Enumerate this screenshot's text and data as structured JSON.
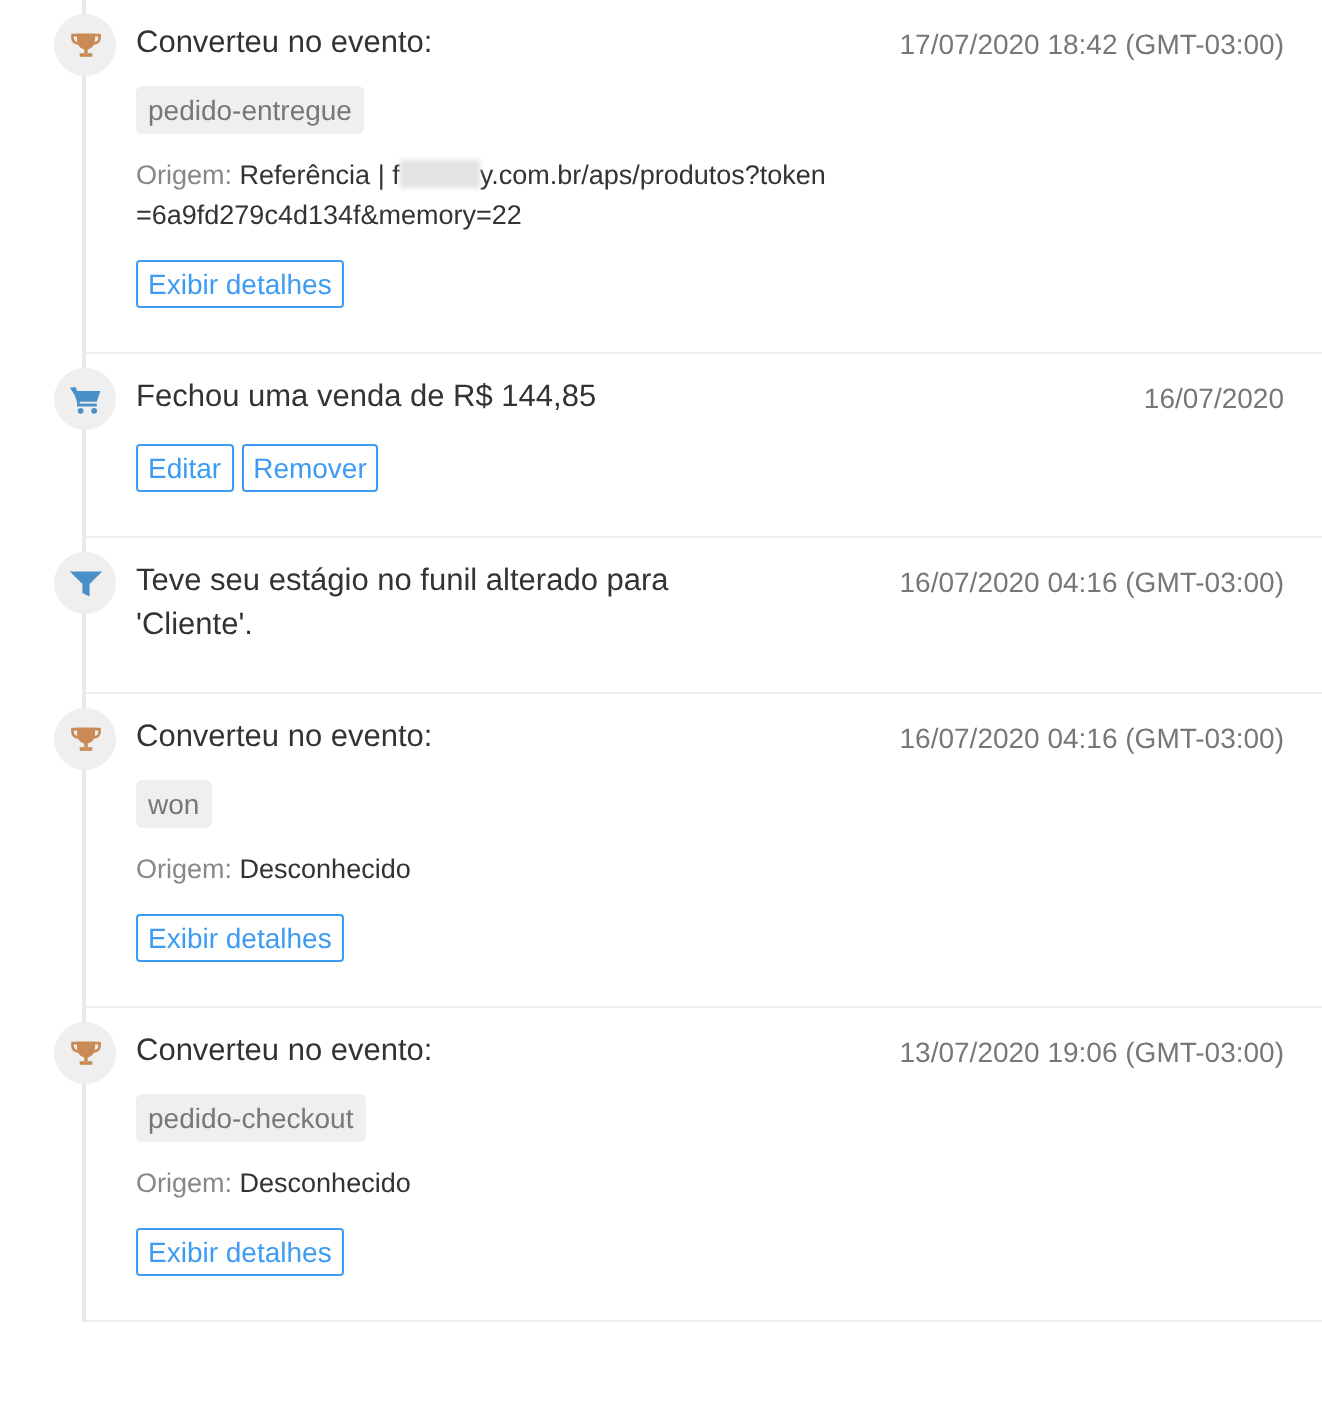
{
  "events": [
    {
      "kind": "conversion",
      "title": "Converteu no evento:",
      "date": "17/07/2020 18:42 (GMT-03:00)",
      "tag": "pedido-entregue",
      "origin_label": "Origem:",
      "origin_before": "Referência | f",
      "origin_redacted": true,
      "origin_after": "y.com.br/aps/produtos?token=6a9fd279c4d134f&memory=22",
      "buttons": [
        "Exibir detalhes"
      ]
    },
    {
      "kind": "sale",
      "title": "Fechou uma venda de R$ 144,85",
      "date": "16/07/2020",
      "buttons": [
        "Editar",
        "Remover"
      ]
    },
    {
      "kind": "funnel",
      "title": "Teve seu estágio no funil alterado para 'Cliente'.",
      "date": "16/07/2020 04:16 (GMT-03:00)"
    },
    {
      "kind": "conversion",
      "title": "Converteu no evento:",
      "date": "16/07/2020 04:16 (GMT-03:00)",
      "tag": "won",
      "origin_label": "Origem:",
      "origin_before": "Desconhecido",
      "buttons": [
        "Exibir detalhes"
      ]
    },
    {
      "kind": "conversion",
      "title": "Converteu no evento:",
      "date": "13/07/2020 19:06 (GMT-03:00)",
      "tag": "pedido-checkout",
      "origin_label": "Origem:",
      "origin_before": "Desconhecido",
      "buttons": [
        "Exibir detalhes"
      ]
    }
  ]
}
